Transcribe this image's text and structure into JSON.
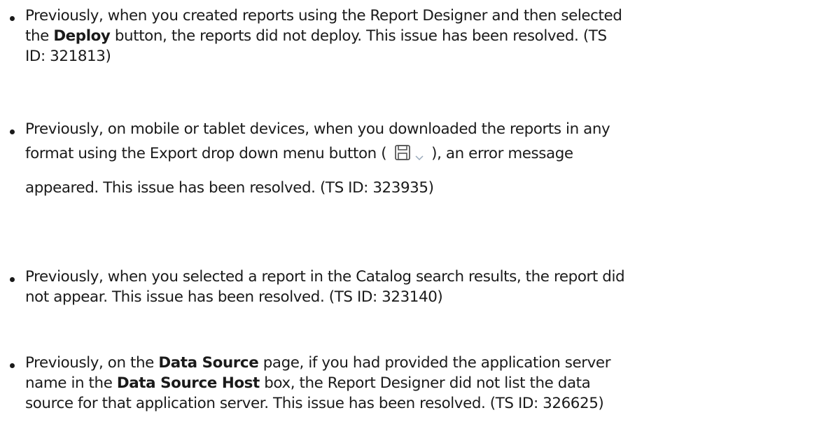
{
  "notes": [
    {
      "line1": "Previously, when you created reports using the Report Designer and then selected",
      "line2_pre": "the ",
      "line2_bold": "Deploy",
      "line2_post": " button, the reports did not deploy. This issue has been resolved. (TS",
      "line3": "ID: 321813)"
    },
    {
      "line1": "Previously, on mobile or tablet devices, when you downloaded the reports in any",
      "line2_pre": "format using the Export drop down menu button (",
      "line2_icon": "save-dropdown-icon",
      "line2_post": "), an error message",
      "line3": "appeared. This issue has been resolved. (TS ID: 323935)"
    },
    {
      "line1": "Previously, when you selected a report in the Catalog search results, the report did",
      "line2": "not appear. This issue has been resolved. (TS ID: 323140)"
    },
    {
      "line1_pre": "Previously, on the ",
      "line1_bold": "Data Source",
      "line1_post": " page, if you had provided the application server",
      "line2_pre": "name in the ",
      "line2_bold": "Data Source Host",
      "line2_post": " box, the Report Designer did not list the data",
      "line3": "source for that application server. This issue has been resolved. (TS ID: 326625)"
    }
  ],
  "colors": {
    "text": "#1a1a1a",
    "icon_stroke": "#555555",
    "chevron": "#9aaabb"
  }
}
